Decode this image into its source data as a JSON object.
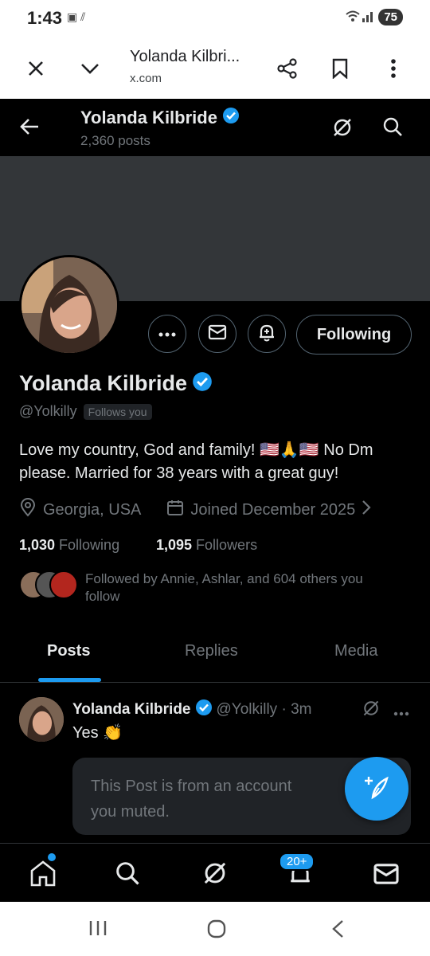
{
  "status_bar": {
    "time": "1:43",
    "battery": "75"
  },
  "browser": {
    "title": "Yolanda Kilbri...",
    "url": "x.com"
  },
  "header": {
    "name": "Yolanda Kilbride",
    "post_count": "2,360 posts"
  },
  "profile": {
    "name": "Yolanda Kilbride",
    "handle": "@Yolkilly",
    "follows_you": "Follows you",
    "bio_line1": "Love my country, God and family! 🇺🇸🙏🇺🇸 No Dm",
    "bio_line2": "please. Married for 38 years with a great guy!",
    "location": "Georgia, USA",
    "joined": "Joined December 2025",
    "following_count": "1,030",
    "following_label": "Following",
    "followers_count": "1,095",
    "followers_label": "Followers",
    "followed_by_line1": "Followed by Annie, Ashlar, and 604 others you",
    "followed_by_line2": "follow",
    "follow_button": "Following"
  },
  "tabs": [
    {
      "label": "Posts",
      "active": true
    },
    {
      "label": "Replies"
    },
    {
      "label": "Media"
    }
  ],
  "post": {
    "name": "Yolanda Kilbride",
    "handle_time": "@Yolkilly · 3m",
    "text": "Yes 👏",
    "muted_line1": "This Post is from an account",
    "muted_line2": "you muted."
  },
  "bottom_nav": {
    "notifications_badge": "20+"
  },
  "colors": {
    "accent": "#1d9bf0",
    "background": "#000000",
    "banner": "#333639"
  }
}
